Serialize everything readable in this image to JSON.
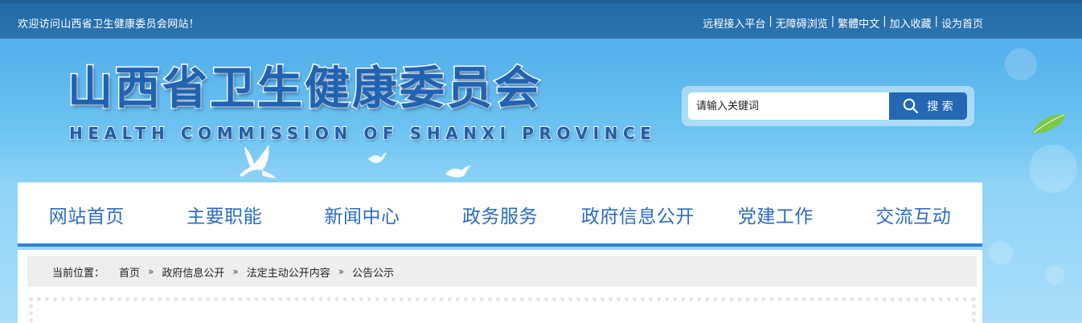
{
  "topbar": {
    "welcome": "欢迎访问山西省卫生健康委员会网站！",
    "links": [
      "远程接入平台",
      "无障碍浏览",
      "繁體中文",
      "加入收藏",
      "设为首页"
    ],
    "separator": "|"
  },
  "header": {
    "title_cn": "山西省卫生健康委员会",
    "title_en": "HEALTH COMMISSION OF SHANXI PROVINCE"
  },
  "search": {
    "placeholder": "请输入关键词",
    "button_label": "搜 索",
    "icon": "search-icon"
  },
  "nav": {
    "items": [
      "网站首页",
      "主要职能",
      "新闻中心",
      "政务服务",
      "政府信息公开",
      "党建工作",
      "交流互动"
    ]
  },
  "breadcrumb": {
    "label": "当前位置：",
    "items": [
      "首页",
      "政府信息公开",
      "法定主动公开内容",
      "公告公示"
    ],
    "separator": "»"
  },
  "colors": {
    "topbar": "#2369a6",
    "brand_blue": "#1f63b3",
    "nav_text": "#2a6cbf",
    "nav_underline": "#2f83d4",
    "search_button": "#2467b3"
  }
}
